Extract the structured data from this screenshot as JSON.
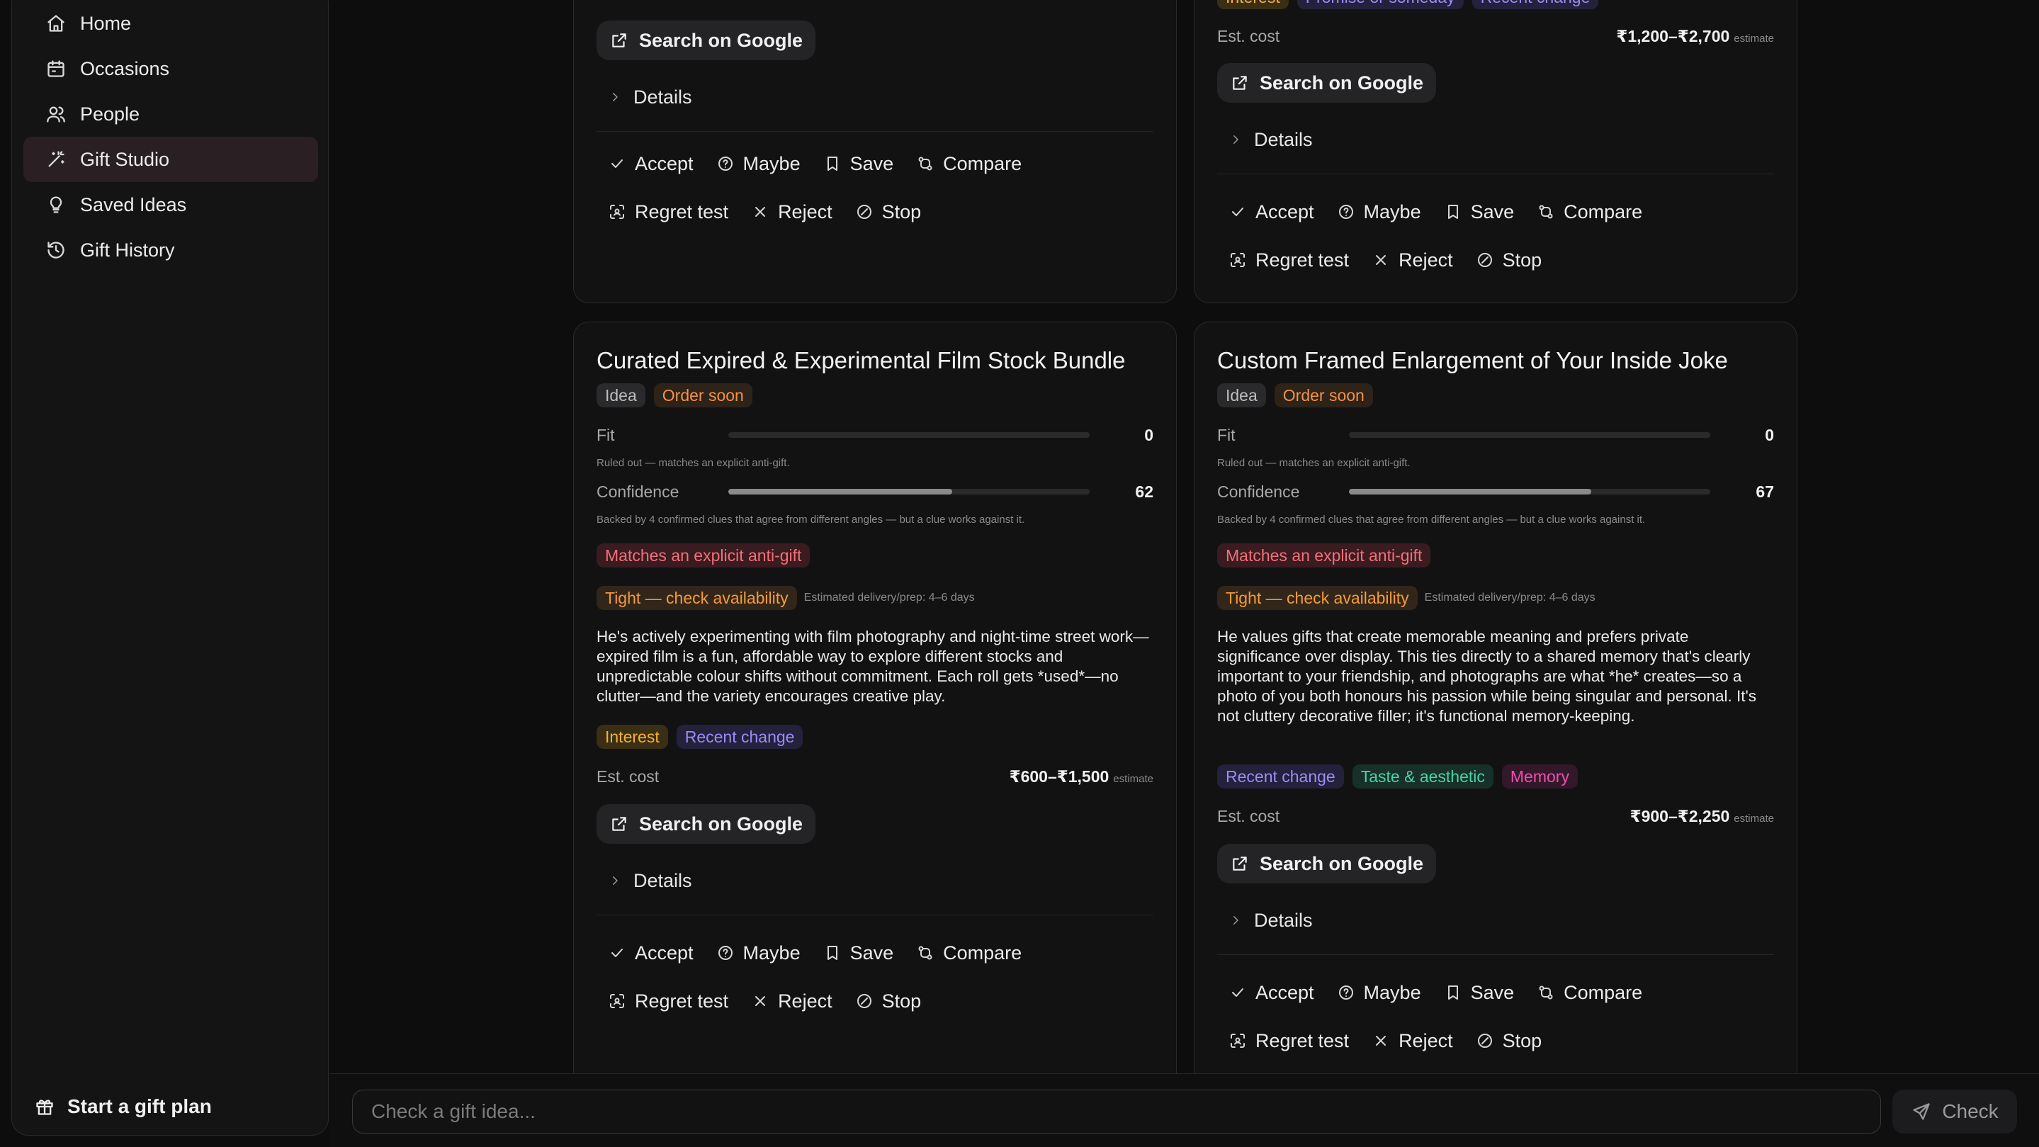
{
  "sidebar": {
    "items": [
      {
        "label": "Home",
        "icon": "home-icon"
      },
      {
        "label": "Occasions",
        "icon": "calendar-icon"
      },
      {
        "label": "People",
        "icon": "users-icon"
      },
      {
        "label": "Gift Studio",
        "icon": "wand-icon",
        "active": true
      },
      {
        "label": "Saved Ideas",
        "icon": "lightbulb-icon"
      },
      {
        "label": "Gift History",
        "icon": "history-icon"
      }
    ],
    "start_plan": "Start a gift plan"
  },
  "top_cards": [
    {
      "google_label": "Search on Google",
      "details_label": "Details"
    },
    {
      "tags_partial": [
        "Interest",
        "Promise or someday",
        "Recent change"
      ],
      "est_label": "Est. cost",
      "est_value": "₹1,200–₹2,700",
      "est_note": "estimate",
      "google_label": "Search on Google",
      "details_label": "Details"
    }
  ],
  "actions": {
    "accept": "Accept",
    "maybe": "Maybe",
    "save": "Save",
    "compare": "Compare",
    "regret": "Regret test",
    "reject": "Reject",
    "stop": "Stop"
  },
  "cards": [
    {
      "title": "Curated Expired & Experimental Film Stock Bundle",
      "tag_idea": "Idea",
      "tag_order": "Order soon",
      "fit_label": "Fit",
      "fit_value": 0,
      "fit_note": "Ruled out — matches an explicit anti-gift.",
      "conf_label": "Confidence",
      "conf_value": 62,
      "conf_note": "Backed by 4 confirmed clues that agree from different angles — but a clue works against it.",
      "warn_tag": "Matches an explicit anti-gift",
      "avail_tag": "Tight — check availability",
      "avail_note": "Estimated delivery/prep: 4–6 days",
      "description": "He's actively experimenting with film photography and night-time street work—expired film is a fun, affordable way to explore different stocks and unpredictable colour shifts without commitment. Each roll gets *used*—no clutter—and the variety encourages creative play.",
      "clue_tags": [
        "Interest",
        "Recent change"
      ],
      "est_label": "Est. cost",
      "est_value": "₹600–₹1,500",
      "est_note": "estimate",
      "google_label": "Search on Google",
      "details_label": "Details"
    },
    {
      "title": "Custom Framed Enlargement of Your Inside Joke",
      "tag_idea": "Idea",
      "tag_order": "Order soon",
      "fit_label": "Fit",
      "fit_value": 0,
      "fit_note": "Ruled out — matches an explicit anti-gift.",
      "conf_label": "Confidence",
      "conf_value": 67,
      "conf_note": "Backed by 4 confirmed clues that agree from different angles — but a clue works against it.",
      "warn_tag": "Matches an explicit anti-gift",
      "avail_tag": "Tight — check availability",
      "avail_note": "Estimated delivery/prep: 4–6 days",
      "description": "He values gifts that create memorable meaning and prefers private significance over display. This ties directly to a shared memory that's clearly important to your friendship, and photographs are what *he* creates—so a photo of you both honours his passion while being singular and personal. It's not cluttery decorative filler; it's functional memory-keeping.",
      "clue_tags": [
        "Recent change",
        "Taste & aesthetic",
        "Memory"
      ],
      "est_label": "Est. cost",
      "est_value": "₹900–₹2,250",
      "est_note": "estimate",
      "google_label": "Search on Google",
      "details_label": "Details"
    }
  ],
  "checker": {
    "placeholder": "Check a gift idea...",
    "button": "Check"
  }
}
